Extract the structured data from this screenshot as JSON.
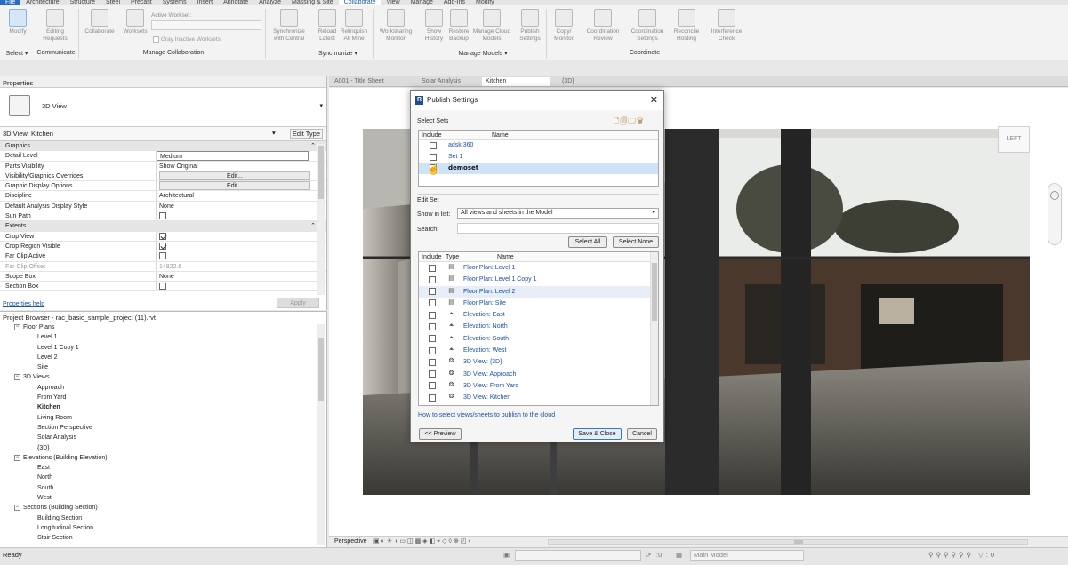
{
  "menu": [
    "File",
    "Architecture",
    "Structure",
    "Steel",
    "Precast",
    "Systems",
    "Insert",
    "Annotate",
    "Analyze",
    "Massing & Site",
    "Collaborate",
    "View",
    "Manage",
    "Add-Ins",
    "Modify"
  ],
  "menu_active": "Collaborate",
  "ribbon": {
    "buttons": {
      "modify": "Modify",
      "editing_requests": "Editing Requests",
      "collaborate": "Collaborate",
      "worksets": "Worksets",
      "active_workset": "Active Workset:",
      "gray_inactive": "Gray Inactive Worksets",
      "sync_central": "Synchronize with Central",
      "reload_latest": "Reload Latest",
      "relinquish": "Relinquish All Mine",
      "worksharing_monitor": "Worksharing Monitor",
      "show_history": "Show History",
      "restore_backup": "Restore Backup",
      "manage_cloud": "Manage Cloud Models",
      "publish_settings": "Publish Settings",
      "copy_monitor": "Copy/ Monitor",
      "coord_review": "Coordination Review",
      "coord_settings": "Coordination Settings",
      "reconcile_hosting": "Reconcile Hosting",
      "interference_check": "Interference Check"
    },
    "groups": {
      "select": "Select ▾",
      "communicate": "Communicate",
      "manage_collab": "Manage Collaboration",
      "synchronize": "Synchronize ▾",
      "manage_models": "Manage Models ▾",
      "coordinate": "Coordinate"
    }
  },
  "properties": {
    "title": "Properties",
    "type_name": "3D View",
    "instance": "3D View: Kitchen",
    "edit_type": "Edit Type",
    "rows": [
      {
        "k": "Graphics",
        "section": true
      },
      {
        "k": "Detail Level",
        "v": "Medium",
        "field": true
      },
      {
        "k": "Parts Visibility",
        "v": "Show Original"
      },
      {
        "k": "Visibility/Graphics Overrides",
        "v": "Edit...",
        "button": true
      },
      {
        "k": "Graphic Display Options",
        "v": "Edit...",
        "button": true
      },
      {
        "k": "Discipline",
        "v": "Architectural"
      },
      {
        "k": "Default Analysis Display Style",
        "v": "None"
      },
      {
        "k": "Sun Path",
        "check": false
      },
      {
        "k": "Extents",
        "section": true
      },
      {
        "k": "Crop View",
        "check": true
      },
      {
        "k": "Crop Region Visible",
        "check": true
      },
      {
        "k": "Far Clip Active",
        "check": false
      },
      {
        "k": "Far Clip Offset",
        "v": "14822.6",
        "dim": true
      },
      {
        "k": "Scope Box",
        "v": "None"
      },
      {
        "k": "Section Box",
        "check": false
      }
    ],
    "help": "Properties help",
    "apply": "Apply"
  },
  "browser": {
    "title": "Project Browser - rac_basic_sample_project (11).rvt",
    "items": [
      {
        "t": "Floor Plans",
        "lvl": 1,
        "tog": "−"
      },
      {
        "t": "Level 1",
        "lvl": 2
      },
      {
        "t": "Level 1 Copy 1",
        "lvl": 2
      },
      {
        "t": "Level 2",
        "lvl": 2
      },
      {
        "t": "Site",
        "lvl": 2
      },
      {
        "t": "3D Views",
        "lvl": 1,
        "tog": "−"
      },
      {
        "t": "Approach",
        "lvl": 2
      },
      {
        "t": "From Yard",
        "lvl": 2
      },
      {
        "t": "Kitchen",
        "lvl": 2,
        "bold": true
      },
      {
        "t": "Living Room",
        "lvl": 2
      },
      {
        "t": "Section Perspective",
        "lvl": 2
      },
      {
        "t": "Solar Analysis",
        "lvl": 2
      },
      {
        "t": "{3D}",
        "lvl": 2
      },
      {
        "t": "Elevations (Building Elevation)",
        "lvl": 1,
        "tog": "−"
      },
      {
        "t": "East",
        "lvl": 2
      },
      {
        "t": "North",
        "lvl": 2
      },
      {
        "t": "South",
        "lvl": 2
      },
      {
        "t": "West",
        "lvl": 2
      },
      {
        "t": "Sections (Building Section)",
        "lvl": 1,
        "tog": "−"
      },
      {
        "t": "Building Section",
        "lvl": 2
      },
      {
        "t": "Longitudinal Section",
        "lvl": 2
      },
      {
        "t": "Stair Section",
        "lvl": 2
      }
    ]
  },
  "view_tabs": [
    "A001 - Title Sheet",
    "Solar Analysis",
    "Kitchen",
    "{3D}"
  ],
  "viewcube_label": "LEFT",
  "viewbar_label": "Perspective",
  "status": {
    "left": "Ready",
    "main_model": "Main Model",
    "zero": ":0"
  },
  "dialog": {
    "title": "Publish Settings",
    "select_sets": "Select Sets",
    "col_include": "Include",
    "col_name": "Name",
    "col_type": "Type",
    "sets": [
      {
        "name": "adsk 360",
        "checked": false
      },
      {
        "name": "Set 1",
        "checked": false
      },
      {
        "name": "demoset",
        "checked": false,
        "selected": true
      }
    ],
    "edit_set": "Edit Set",
    "show_in_list": "Show in list:",
    "show_value": "All views and sheets in the Model",
    "search": "Search:",
    "select_all": "Select All",
    "select_none": "Select None",
    "views": [
      {
        "name": "Floor Plan: Level 1",
        "type": "plan"
      },
      {
        "name": "Floor Plan: Level 1 Copy 1",
        "type": "plan"
      },
      {
        "name": "Floor Plan: Level 2",
        "type": "plan",
        "selected": true
      },
      {
        "name": "Floor Plan: Site",
        "type": "plan"
      },
      {
        "name": "Elevation: East",
        "type": "elev"
      },
      {
        "name": "Elevation: North",
        "type": "elev"
      },
      {
        "name": "Elevation: South",
        "type": "elev"
      },
      {
        "name": "Elevation: West",
        "type": "elev"
      },
      {
        "name": "3D View: {3D}",
        "type": "3d"
      },
      {
        "name": "3D View: Approach",
        "type": "3d"
      },
      {
        "name": "3D View: From Yard",
        "type": "3d"
      },
      {
        "name": "3D View: Kitchen",
        "type": "3d"
      }
    ],
    "help_link": "How to select views/sheets to publish to the cloud",
    "preview": "<< Preview",
    "save_close": "Save & Close",
    "cancel": "Cancel"
  }
}
